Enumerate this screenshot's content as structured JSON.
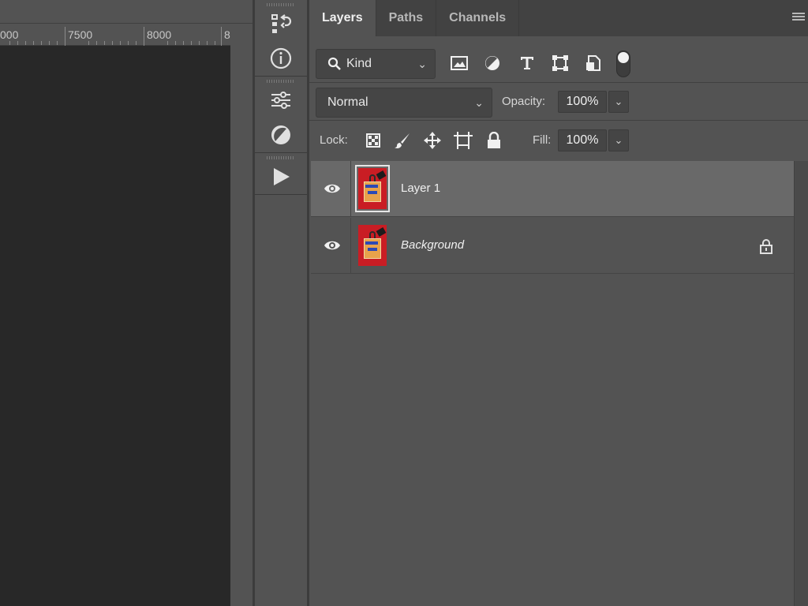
{
  "ruler": {
    "labels": [
      "000",
      "7500",
      "8000",
      "8"
    ]
  },
  "dock": {
    "buttons": [
      {
        "icon": "history-icon"
      },
      {
        "icon": "info-icon"
      },
      {
        "icon": "properties-icon"
      },
      {
        "icon": "adjustments-icon"
      },
      {
        "icon": "actions-play-icon"
      }
    ]
  },
  "panel": {
    "tabs": [
      {
        "label": "Layers",
        "active": true
      },
      {
        "label": "Paths",
        "active": false
      },
      {
        "label": "Channels",
        "active": false
      }
    ],
    "filter": {
      "kind_label": "Kind",
      "filter_icons": [
        "pixel-layer-filter-icon",
        "adjustment-layer-filter-icon",
        "type-layer-filter-icon",
        "shape-layer-filter-icon",
        "smart-object-filter-icon"
      ],
      "toggle_on": true
    },
    "blend": {
      "mode": "Normal",
      "opacity_label": "Opacity:",
      "opacity_value": "100%"
    },
    "lock": {
      "label": "Lock:",
      "icons": [
        "lock-transparent-pixels-icon",
        "lock-image-pixels-icon",
        "lock-position-icon",
        "lock-artboard-icon",
        "lock-all-icon"
      ],
      "fill_label": "Fill:",
      "fill_value": "100%"
    },
    "layers": [
      {
        "name": "Layer 1",
        "visible": true,
        "selected": true,
        "locked": false,
        "italic": false
      },
      {
        "name": "Background",
        "visible": true,
        "selected": false,
        "locked": true,
        "italic": true
      }
    ]
  },
  "colors": {
    "panel_bg": "#535353",
    "tab_bar_bg": "#424242",
    "document_bg": "#282828",
    "selected_row": "#696969",
    "thumb_red": "#c91d24"
  }
}
